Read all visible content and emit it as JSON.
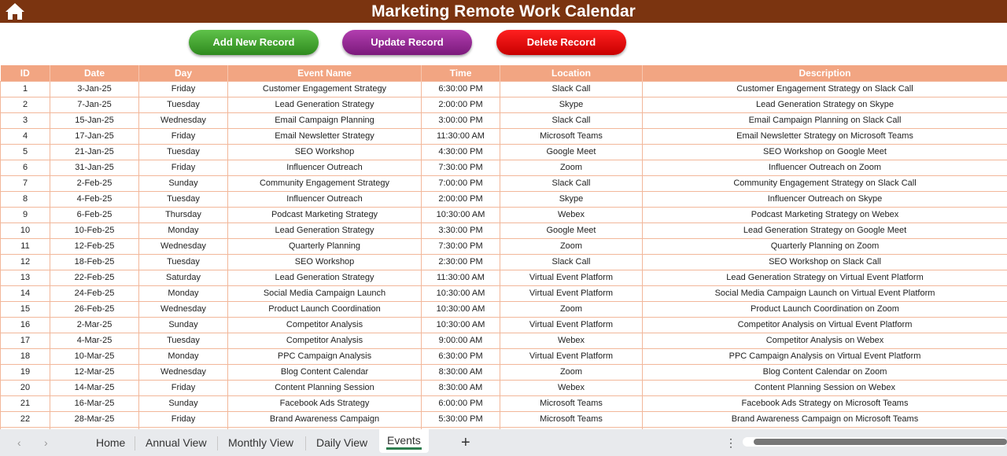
{
  "header": {
    "title": "Marketing Remote Work Calendar"
  },
  "buttons": {
    "add": "Add New Record",
    "update": "Update Record",
    "delete": "Delete Record"
  },
  "table": {
    "columns": [
      "ID",
      "Date",
      "Day",
      "Event Name",
      "Time",
      "Location",
      "Description"
    ],
    "rows": [
      [
        "1",
        "3-Jan-25",
        "Friday",
        "Customer Engagement Strategy",
        "6:30:00 PM",
        "Slack Call",
        "Customer Engagement Strategy on Slack Call"
      ],
      [
        "2",
        "7-Jan-25",
        "Tuesday",
        "Lead Generation Strategy",
        "2:00:00 PM",
        "Skype",
        "Lead Generation Strategy on Skype"
      ],
      [
        "3",
        "15-Jan-25",
        "Wednesday",
        "Email Campaign Planning",
        "3:00:00 PM",
        "Slack Call",
        "Email Campaign Planning on Slack Call"
      ],
      [
        "4",
        "17-Jan-25",
        "Friday",
        "Email Newsletter Strategy",
        "11:30:00 AM",
        "Microsoft Teams",
        "Email Newsletter Strategy on Microsoft Teams"
      ],
      [
        "5",
        "21-Jan-25",
        "Tuesday",
        "SEO Workshop",
        "4:30:00 PM",
        "Google Meet",
        "SEO Workshop on Google Meet"
      ],
      [
        "6",
        "31-Jan-25",
        "Friday",
        "Influencer Outreach",
        "7:30:00 PM",
        "Zoom",
        "Influencer Outreach on Zoom"
      ],
      [
        "7",
        "2-Feb-25",
        "Sunday",
        "Community Engagement Strategy",
        "7:00:00 PM",
        "Slack Call",
        "Community Engagement Strategy on Slack Call"
      ],
      [
        "8",
        "4-Feb-25",
        "Tuesday",
        "Influencer Outreach",
        "2:00:00 PM",
        "Skype",
        "Influencer Outreach on Skype"
      ],
      [
        "9",
        "6-Feb-25",
        "Thursday",
        "Podcast Marketing Strategy",
        "10:30:00 AM",
        "Webex",
        "Podcast Marketing Strategy on Webex"
      ],
      [
        "10",
        "10-Feb-25",
        "Monday",
        "Lead Generation Strategy",
        "3:30:00 PM",
        "Google Meet",
        "Lead Generation Strategy on Google Meet"
      ],
      [
        "11",
        "12-Feb-25",
        "Wednesday",
        "Quarterly Planning",
        "7:30:00 PM",
        "Zoom",
        "Quarterly Planning on Zoom"
      ],
      [
        "12",
        "18-Feb-25",
        "Tuesday",
        "SEO Workshop",
        "2:30:00 PM",
        "Slack Call",
        "SEO Workshop on Slack Call"
      ],
      [
        "13",
        "22-Feb-25",
        "Saturday",
        "Lead Generation Strategy",
        "11:30:00 AM",
        "Virtual Event Platform",
        "Lead Generation Strategy on Virtual Event Platform"
      ],
      [
        "14",
        "24-Feb-25",
        "Monday",
        "Social Media Campaign Launch",
        "10:30:00 AM",
        "Virtual Event Platform",
        "Social Media Campaign Launch on Virtual Event Platform"
      ],
      [
        "15",
        "26-Feb-25",
        "Wednesday",
        "Product Launch Coordination",
        "10:30:00 AM",
        "Zoom",
        "Product Launch Coordination on Zoom"
      ],
      [
        "16",
        "2-Mar-25",
        "Sunday",
        "Competitor Analysis",
        "10:30:00 AM",
        "Virtual Event Platform",
        "Competitor Analysis on Virtual Event Platform"
      ],
      [
        "17",
        "4-Mar-25",
        "Tuesday",
        "Competitor Analysis",
        "9:00:00 AM",
        "Webex",
        "Competitor Analysis on Webex"
      ],
      [
        "18",
        "10-Mar-25",
        "Monday",
        "PPC Campaign Analysis",
        "6:30:00 PM",
        "Virtual Event Platform",
        "PPC Campaign Analysis on Virtual Event Platform"
      ],
      [
        "19",
        "12-Mar-25",
        "Wednesday",
        "Blog Content Calendar",
        "8:30:00 AM",
        "Zoom",
        "Blog Content Calendar on Zoom"
      ],
      [
        "20",
        "14-Mar-25",
        "Friday",
        "Content Planning Session",
        "8:30:00 AM",
        "Webex",
        "Content Planning Session on Webex"
      ],
      [
        "21",
        "16-Mar-25",
        "Sunday",
        "Facebook Ads Strategy",
        "6:00:00 PM",
        "Microsoft Teams",
        "Facebook Ads Strategy on Microsoft Teams"
      ],
      [
        "22",
        "28-Mar-25",
        "Friday",
        "Brand Awareness Campaign",
        "5:30:00 PM",
        "Microsoft Teams",
        "Brand Awareness Campaign on Microsoft Teams"
      ]
    ]
  },
  "sheet_tabs": [
    "Home",
    "Annual View",
    "Monthly View",
    "Daily View",
    "Events"
  ],
  "active_tab": "Events",
  "colors": {
    "title_bg": "#7b3410",
    "header_bg": "#f2a582",
    "add": "#3fa52f",
    "update": "#962a95",
    "delete": "#e00000"
  }
}
